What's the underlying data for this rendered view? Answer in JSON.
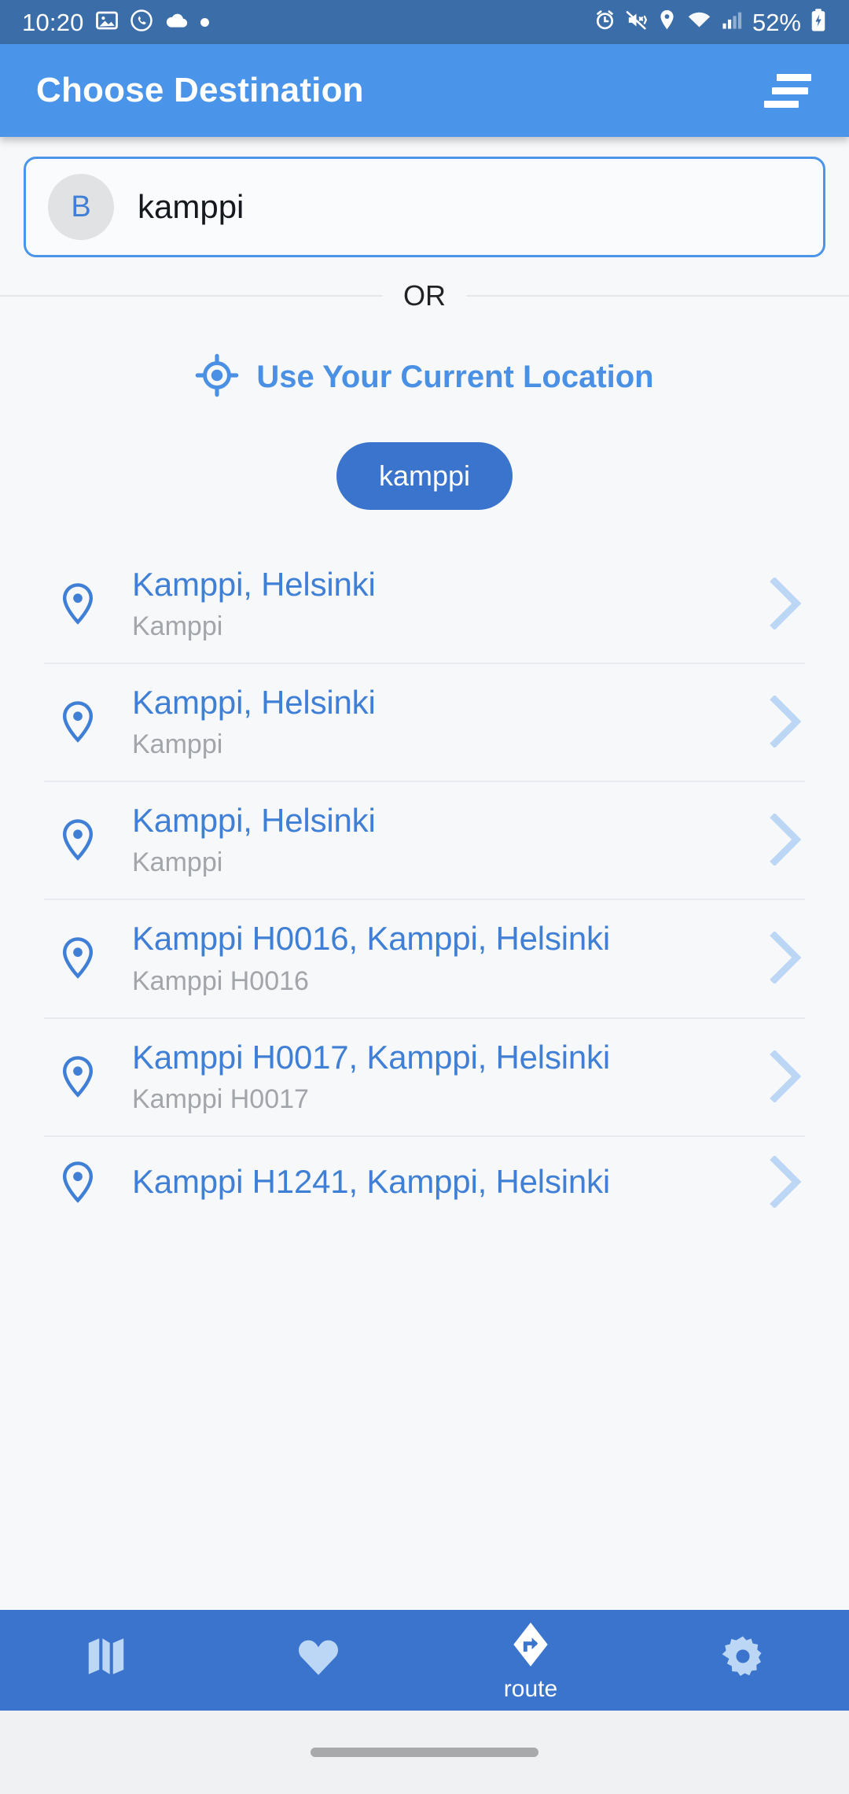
{
  "status_bar": {
    "time": "10:20",
    "battery_percent": "52%",
    "left_icons": [
      "photos-icon",
      "whatsapp-icon",
      "cloud-icon",
      "dot-indicator-icon"
    ],
    "right_icons": [
      "alarm-icon",
      "mute-vibrate-icon",
      "location-icon",
      "wifi-icon",
      "cellular-signal-icon",
      "battery-charging-icon"
    ]
  },
  "app_bar": {
    "title": "Choose Destination",
    "menu_icon": "hamburger-menu-icon"
  },
  "search": {
    "avatar_letter": "B",
    "value": "kamppi",
    "placeholder": "kamppi"
  },
  "divider": {
    "or_label": "OR"
  },
  "current_location": {
    "label": "Use Your Current Location",
    "icon": "gps-crosshair-icon"
  },
  "query_chip": {
    "label": "kamppi"
  },
  "results": [
    {
      "title": "Kamppi, Helsinki",
      "subtitle": "Kamppi"
    },
    {
      "title": "Kamppi, Helsinki",
      "subtitle": "Kamppi"
    },
    {
      "title": "Kamppi, Helsinki",
      "subtitle": "Kamppi"
    },
    {
      "title": "Kamppi H0016, Kamppi, Helsinki",
      "subtitle": "Kamppi H0016"
    },
    {
      "title": "Kamppi H0017, Kamppi, Helsinki",
      "subtitle": "Kamppi H0017"
    },
    {
      "title": "Kamppi H1241, Kamppi, Helsinki",
      "subtitle": ""
    }
  ],
  "bottom_nav": [
    {
      "icon": "map-icon",
      "label": "",
      "active": false
    },
    {
      "icon": "heart-icon",
      "label": "",
      "active": false
    },
    {
      "icon": "route-sign-icon",
      "label": "route",
      "active": true
    },
    {
      "icon": "gear-icon",
      "label": "",
      "active": false
    }
  ],
  "colors": {
    "status_bar_bg": "#3b6ea8",
    "app_bar_bg": "#4a94ea",
    "accent_blue": "#3f7fd6",
    "chip_bg": "#3a74cc",
    "nav_bg": "#3a74cc",
    "page_bg": "#f7f8f9",
    "subtitle_gray": "#a2a5a9"
  }
}
